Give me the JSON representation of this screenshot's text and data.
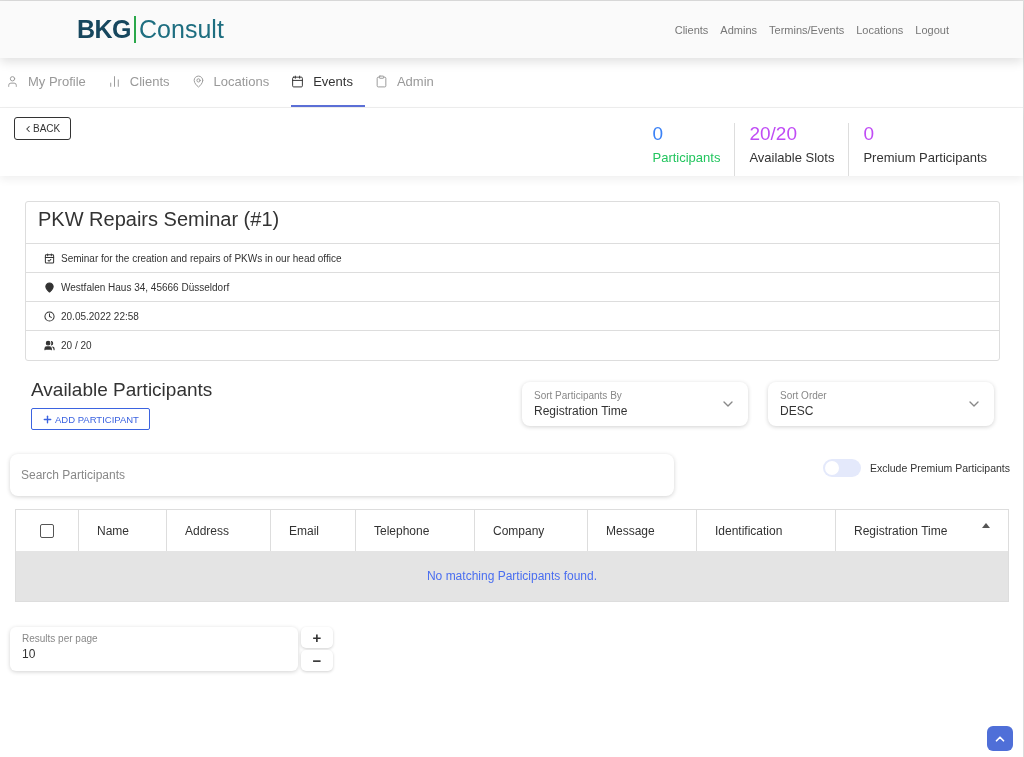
{
  "header": {
    "logo": {
      "part_1": "BKG",
      "part_2": "Consult"
    },
    "links": [
      "Clients",
      "Admins",
      "Termins/Events",
      "Locations",
      "Logout"
    ]
  },
  "tabs": [
    {
      "kind": "profile",
      "label": "My Profile",
      "selected": false
    },
    {
      "kind": "clients",
      "label": "Clients",
      "selected": false
    },
    {
      "kind": "locations",
      "label": "Locations",
      "selected": false
    },
    {
      "kind": "events",
      "label": "Events",
      "selected": true
    },
    {
      "kind": "admin",
      "label": "Admin",
      "selected": false
    }
  ],
  "back_button": "BACK",
  "stats": [
    {
      "value": {
        "text": "0",
        "color": "#3b82f6"
      },
      "label": {
        "text": "Participants",
        "color": "#22c55e"
      }
    },
    {
      "value": {
        "text": "20/20",
        "color": "#c04cf5"
      },
      "label": {
        "text": "Available Slots",
        "color": "#333333"
      }
    },
    {
      "value": {
        "text": "0",
        "color": "#c04cf5"
      },
      "label": {
        "text": "Premium Participants",
        "color": "#333333"
      }
    }
  ],
  "event": {
    "title": "PKW Repairs Seminar (#1)",
    "details": [
      {
        "kind": "description",
        "text": "Seminar for the creation and repairs of PKWs in our head office"
      },
      {
        "kind": "location",
        "text": "Westfalen Haus 34, 45666 Düsseldorf"
      },
      {
        "kind": "time",
        "text": "20.05.2022 22:58"
      },
      {
        "kind": "capacity",
        "text": "20 / 20"
      }
    ]
  },
  "participants": {
    "heading": "Available Participants",
    "add_button": "ADD PARTICIPANT",
    "selects": [
      {
        "label": "Sort Participants By",
        "value": "Registration Time"
      },
      {
        "label": "Sort Order",
        "value": "DESC"
      }
    ],
    "search": {
      "placeholder": "Search Participants"
    },
    "toggle": {
      "label": "Exclude Premium Participants",
      "on": false
    },
    "table": {
      "select_all_checked": false,
      "columns": [
        {
          "label": "Name",
          "sorted": false
        },
        {
          "label": "Address",
          "sorted": false
        },
        {
          "label": "Email",
          "sorted": false
        },
        {
          "label": "Telephone",
          "sorted": false
        },
        {
          "label": "Company",
          "sorted": false
        },
        {
          "label": "Message",
          "sorted": false
        },
        {
          "label": "Identification",
          "sorted": false
        },
        {
          "label": "Registration Time",
          "sorted": true
        }
      ],
      "empty_message": "No matching Participants found."
    },
    "results_per_page": {
      "label": "Results per page",
      "value": "10",
      "increment": "+",
      "decrement": "−"
    }
  }
}
